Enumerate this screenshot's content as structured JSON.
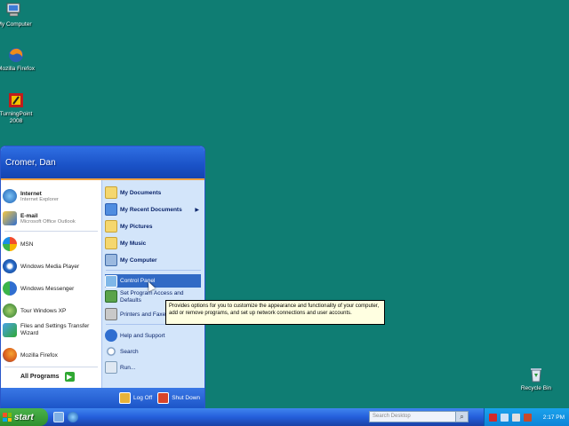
{
  "desktop": {
    "icons": [
      {
        "label": "My Computer",
        "icon": "my-computer-icon"
      },
      {
        "label": "Mozilla Firefox",
        "icon": "firefox-icon"
      },
      {
        "label": "TurningPoint 2008",
        "icon": "turningpoint-icon"
      },
      {
        "label": "Recycle Bin",
        "icon": "recycle-bin-icon"
      }
    ],
    "background_color": "#0f7d73"
  },
  "start_menu": {
    "user_name": "Cromer, Dan",
    "pinned": [
      {
        "title": "Internet",
        "subtitle": "Internet Explorer",
        "icon": "internet-explorer-icon"
      },
      {
        "title": "E-mail",
        "subtitle": "Microsoft Office Outlook",
        "icon": "outlook-icon"
      }
    ],
    "recent": [
      {
        "label": "MSN",
        "icon": "msn-icon"
      },
      {
        "label": "Windows Media Player",
        "icon": "media-player-icon"
      },
      {
        "label": "Windows Messenger",
        "icon": "messenger-icon"
      },
      {
        "label": "Tour Windows XP",
        "icon": "tour-xp-icon"
      },
      {
        "label": "Files and Settings Transfer Wizard",
        "icon": "transfer-wizard-icon"
      },
      {
        "label": "Mozilla Firefox",
        "icon": "firefox-icon"
      }
    ],
    "all_programs": "All Programs",
    "places": [
      {
        "label": "My Documents",
        "icon": "folder-icon"
      },
      {
        "label": "My Recent Documents",
        "icon": "recent-docs-icon"
      },
      {
        "label": "My Pictures",
        "icon": "pictures-icon"
      },
      {
        "label": "My Music",
        "icon": "music-icon"
      },
      {
        "label": "My Computer",
        "icon": "my-computer-icon"
      }
    ],
    "system": [
      {
        "label": "Control Panel",
        "icon": "control-panel-icon"
      },
      {
        "label": "Set Program Access and Defaults",
        "icon": "program-access-icon"
      },
      {
        "label": "Printers and Faxes",
        "icon": "printer-icon"
      }
    ],
    "help": [
      {
        "label": "Help and Support",
        "icon": "help-icon"
      },
      {
        "label": "Search",
        "icon": "search-icon"
      },
      {
        "label": "Run...",
        "icon": "run-icon"
      }
    ],
    "log_off": "Log Off",
    "shut_down": "Shut Down"
  },
  "tooltip": {
    "text": "Provides options for you to customize the appearance and functionality of your computer, add or remove programs, and set up network connections and user accounts."
  },
  "taskbar": {
    "start_label": "start",
    "search_placeholder": "Search Desktop",
    "clock": "2:17 PM"
  },
  "colors": {
    "start_header": "#1a52c7",
    "start_button": "#2e8f2e",
    "selected_item": "#316ac5",
    "tooltip_bg": "#ffffe1"
  }
}
